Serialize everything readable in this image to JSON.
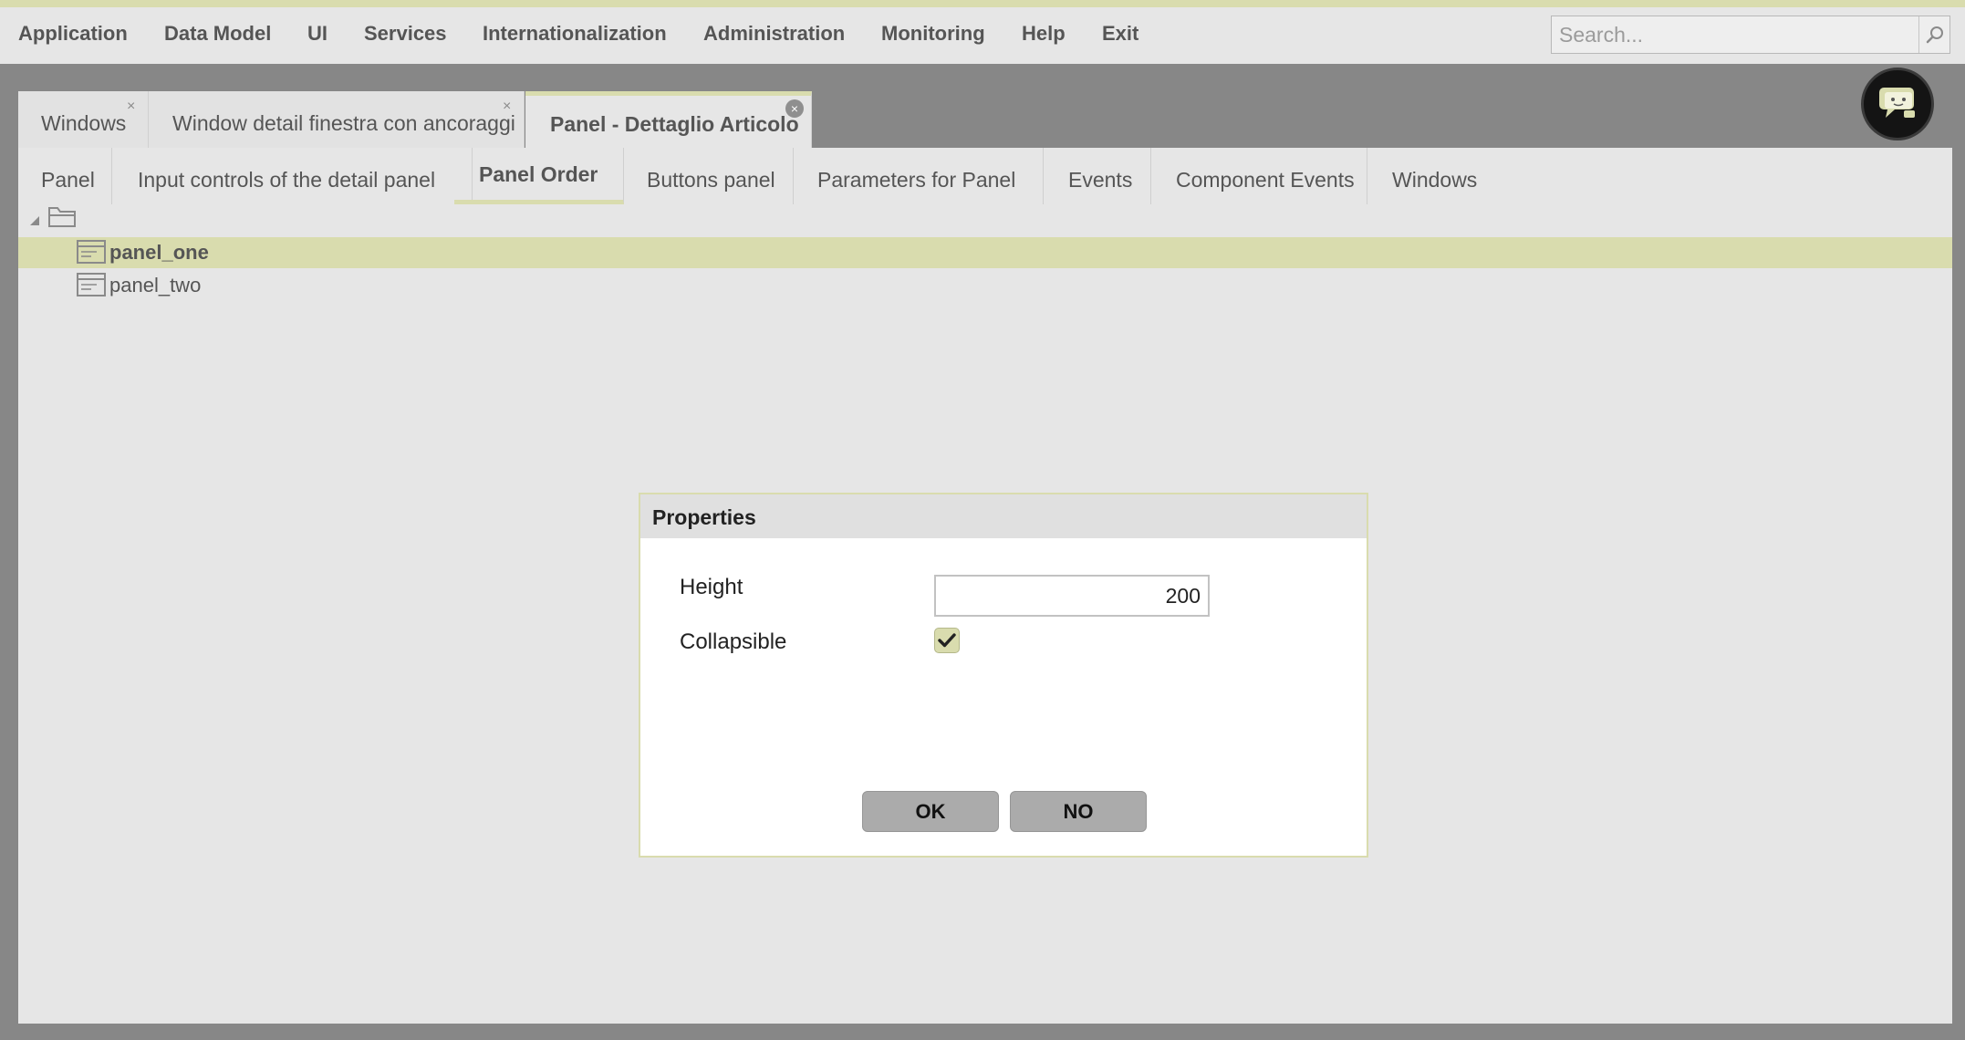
{
  "menu": {
    "items": [
      {
        "label": "Application"
      },
      {
        "label": "Data Model"
      },
      {
        "label": "UI"
      },
      {
        "label": "Services"
      },
      {
        "label": "Internationalization"
      },
      {
        "label": "Administration"
      },
      {
        "label": "Monitoring"
      },
      {
        "label": "Help"
      },
      {
        "label": "Exit"
      }
    ],
    "search_placeholder": "Search..."
  },
  "window_tabs": [
    {
      "label": "Windows",
      "close": "×"
    },
    {
      "label": "Window detail finestra con ancoraggi",
      "close": "×"
    },
    {
      "label": "Panel - Dettaglio Articolo",
      "close": "×",
      "active": true
    }
  ],
  "detail_tabs": [
    {
      "label": "Panel"
    },
    {
      "label": "Input controls of the detail panel"
    },
    {
      "label": "Panel Order",
      "active": true
    },
    {
      "label": "Buttons panel"
    },
    {
      "label": "Parameters for Panel"
    },
    {
      "label": "Events"
    },
    {
      "label": "Component Events"
    },
    {
      "label": "Windows"
    }
  ],
  "tree": {
    "items": [
      {
        "label": "panel_one",
        "selected": true
      },
      {
        "label": "panel_two"
      }
    ]
  },
  "dialog": {
    "title": "Properties",
    "height_label": "Height",
    "height_value": "200",
    "collapsible_label": "Collapsible",
    "collapsible_checked": true,
    "ok_label": "OK",
    "no_label": "NO"
  },
  "colors": {
    "accent": "#d9dcae",
    "background": "#878787",
    "panel": "#e6e6e6"
  },
  "icons": [
    "search-icon",
    "chat-assistant-icon",
    "folder-icon",
    "panel-icon",
    "checkmark-icon",
    "close-icon",
    "tree-expand-icon"
  ]
}
